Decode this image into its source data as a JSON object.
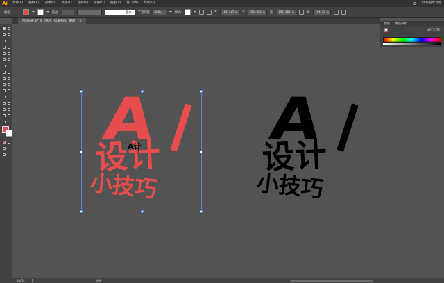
{
  "app": {
    "logo": "Ai",
    "workspace": "传统基本功能"
  },
  "menu": {
    "items": [
      "文件(F)",
      "编辑(E)",
      "对象(O)",
      "文字(T)",
      "选择(S)",
      "效果(C)",
      "视图(V)",
      "窗口(W)",
      "帮助(H)"
    ]
  },
  "controlbar": {
    "group_label": "编组",
    "stroke_label": "描边:",
    "brush_label": "基本",
    "opacity_label": "不透明度",
    "opacity_value": "100%",
    "style_label": "样式:",
    "x_label": "X:",
    "x_value": "-80.447 m",
    "y_label": "Y:",
    "y_value": "551.262 m",
    "w_label": "宽:",
    "w_value": "155.185 m",
    "h_label": "高:",
    "h_value": "154.23 m"
  },
  "document": {
    "tab_title": "AI设计课.ai* @ 100% (RGB/GPU 预览)",
    "close": "×"
  },
  "panels": {
    "color_tab": "颜色",
    "guide_tab": "颜色参考",
    "hex_value": "#FF3035"
  },
  "artwork": {
    "line1": "A",
    "line2": "设计",
    "line3": "小技巧",
    "small_logo": "A计",
    "colors": {
      "red": "#e84d4d",
      "black": "#000000",
      "selection": "#5b7fd6"
    }
  },
  "status": {
    "zoom": "100%",
    "page": "1",
    "mode": "选择"
  }
}
